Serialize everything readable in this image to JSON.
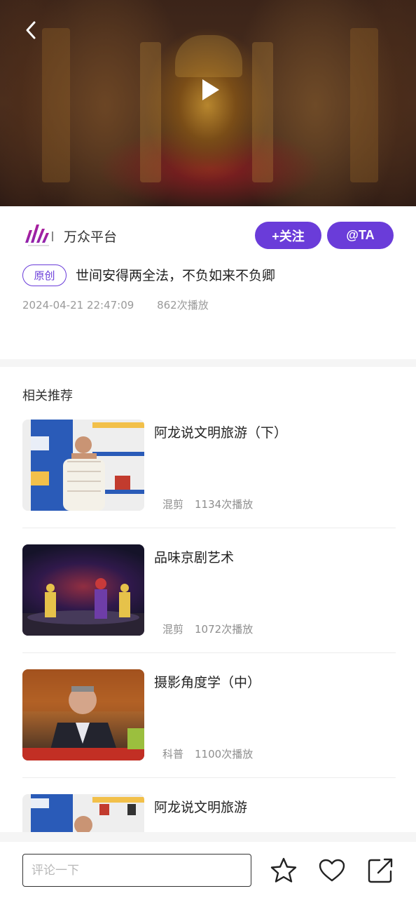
{
  "video": {
    "back_icon": "chevron-left-icon",
    "play_icon": "play-icon"
  },
  "author": {
    "name": "万众平台",
    "follow_label": "+关注",
    "at_label": "@TA",
    "accent_color": "#6a3cd9"
  },
  "post": {
    "tag": "原创",
    "title": "世间安得两全法，不负如来不负卿",
    "date": "2024-04-21 22:47:09",
    "plays": "862次播放"
  },
  "recommendations": {
    "heading": "相关推荐",
    "items": [
      {
        "title": "阿龙说文明旅游（下）",
        "category": "混剪",
        "plays": "1134次播放"
      },
      {
        "title": "品味京剧艺术",
        "category": "混剪",
        "plays": "1072次播放"
      },
      {
        "title": "摄影角度学（中）",
        "category": "科普",
        "plays": "1100次播放"
      },
      {
        "title": "阿龙说文明旅游",
        "category": "",
        "plays": ""
      }
    ]
  },
  "bottom_bar": {
    "comment_placeholder": "评论一下",
    "icons": [
      "star-icon",
      "heart-icon",
      "share-icon"
    ]
  }
}
